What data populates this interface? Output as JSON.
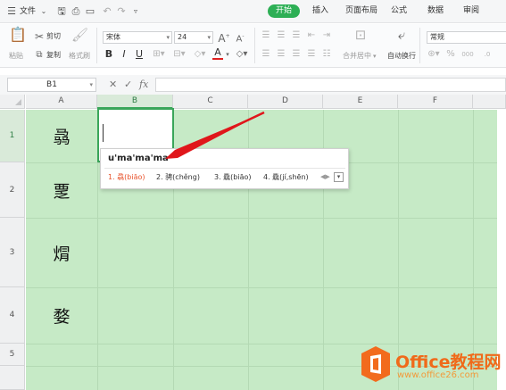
{
  "menubar": {
    "file_label": "文件",
    "tabs": [
      "开始",
      "插入",
      "页面布局",
      "公式",
      "数据",
      "审阅"
    ],
    "active_tab": "开始",
    "accent_color": "#2daf55"
  },
  "ribbon": {
    "paste_label": "粘贴",
    "cut_label": "剪切",
    "copy_label": "复制",
    "format_painter_label": "格式刷",
    "font_name": "宋体",
    "font_size": "24",
    "bold": "B",
    "italic": "I",
    "underline": "U",
    "merge_center_label": "合并居中",
    "wrap_text_label": "自动换行",
    "number_format": "常规",
    "font_color": "#e02020"
  },
  "formula_bar": {
    "name_box": "B1",
    "cancel_icon": "✕",
    "confirm_icon": "✓",
    "fx_label": "fx",
    "content": ""
  },
  "sheet": {
    "columns": [
      "A",
      "B",
      "C",
      "D",
      "E",
      "F"
    ],
    "selected_column": "B",
    "rows": [
      "1",
      "2",
      "3",
      "4",
      "5"
    ],
    "selected_row": "1",
    "cells": {
      "A1": "骉",
      "A2": "覂",
      "A3": "焨",
      "A4": "婺"
    },
    "background_color": "#c6eac6"
  },
  "ime_popup": {
    "composition": "u'ma'ma'ma",
    "candidates": [
      "1. 骉(biāo)",
      "2. 骋(chěng)",
      "3. 驫(biāo)",
      "4. 驫(jí,shēn)"
    ]
  },
  "watermark": {
    "name": "Office教程网",
    "url": "www.office26.com"
  }
}
